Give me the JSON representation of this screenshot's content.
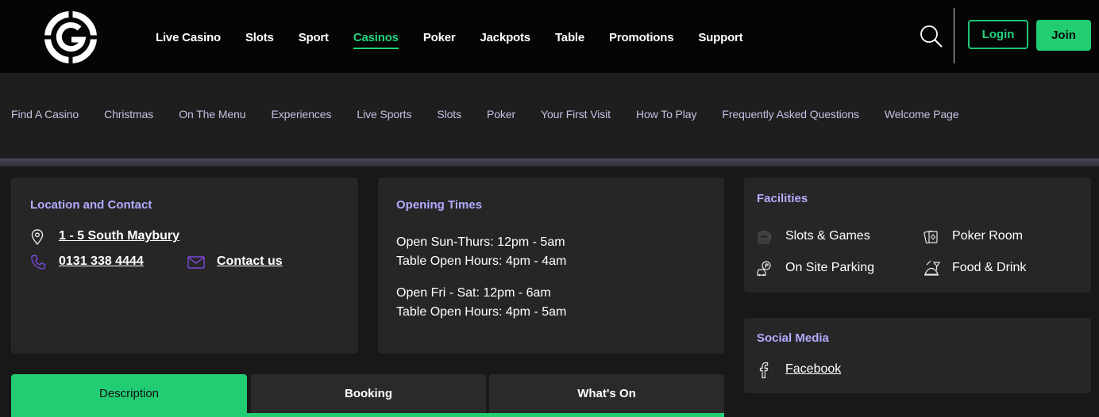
{
  "header": {
    "nav": [
      {
        "label": "Live Casino",
        "active": false
      },
      {
        "label": "Slots",
        "active": false
      },
      {
        "label": "Sport",
        "active": false
      },
      {
        "label": "Casinos",
        "active": true
      },
      {
        "label": "Poker",
        "active": false
      },
      {
        "label": "Jackpots",
        "active": false
      },
      {
        "label": "Table",
        "active": false
      },
      {
        "label": "Promotions",
        "active": false
      },
      {
        "label": "Support",
        "active": false
      }
    ],
    "login_label": "Login",
    "join_label": "Join"
  },
  "subnav": [
    "Find A Casino",
    "Christmas",
    "On The Menu",
    "Experiences",
    "Live Sports",
    "Slots",
    "Poker",
    "Your First Visit",
    "How To Play",
    "Frequently Asked Questions",
    "Welcome Page"
  ],
  "location": {
    "title": "Location and Contact",
    "address": "1 - 5 South Maybury",
    "phone": "0131 338 4444",
    "contact": "Contact us"
  },
  "hours": {
    "title": "Opening Times",
    "block1_line1": "Open Sun-Thurs: 12pm - 5am",
    "block1_line2": "Table Open Hours: 4pm - 4am",
    "block2_line1": "Open Fri - Sat: 12pm - 6am",
    "block2_line2": "Table Open Hours: 4pm - 5am"
  },
  "facilities": {
    "title": "Facilities",
    "items": [
      "Slots & Games",
      "Poker Room",
      "On Site Parking",
      "Food & Drink"
    ]
  },
  "social": {
    "title": "Social Media",
    "facebook": "Facebook"
  },
  "tabs": [
    {
      "label": "Description",
      "active": true
    },
    {
      "label": "Booking",
      "active": false
    },
    {
      "label": "What's On",
      "active": false
    }
  ],
  "colors": {
    "accent": "#22cc72",
    "heading": "#b3acff",
    "subnav_text": "#c5c0e3",
    "icon_purple": "#7b4ad9"
  }
}
